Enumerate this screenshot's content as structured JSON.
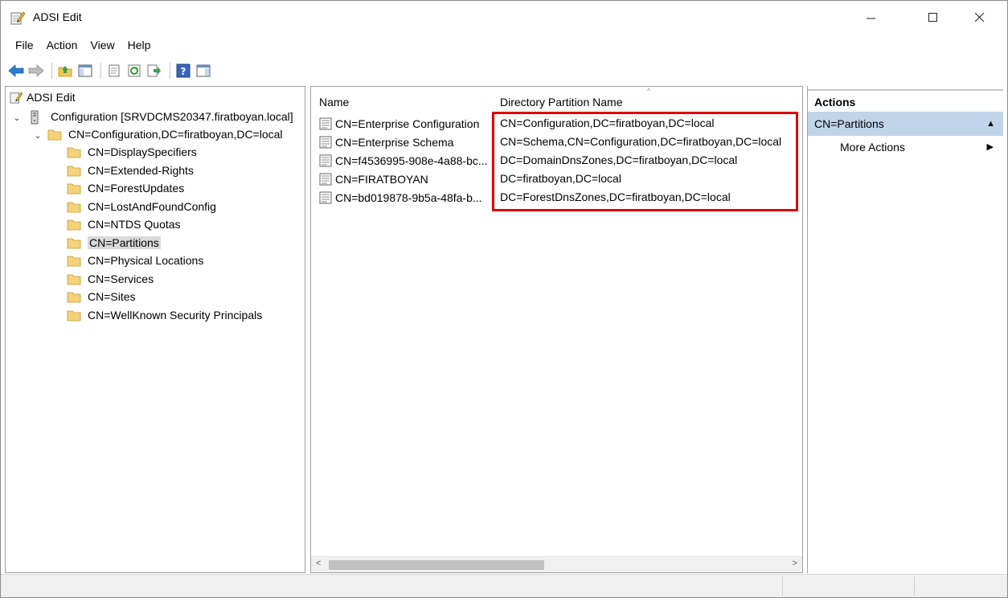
{
  "window": {
    "title": "ADSI Edit"
  },
  "menu": [
    "File",
    "Action",
    "View",
    "Help"
  ],
  "toolbar": {
    "buttons": [
      "back-arrow-icon",
      "forward-arrow-icon",
      "up-folder-icon",
      "show-hide-tree-icon",
      "properties-icon",
      "refresh-icon",
      "export-list-icon",
      "help-icon",
      "show-hide-action-pane-icon"
    ]
  },
  "tree": {
    "root": "ADSI Edit",
    "connection": "Configuration [SRVDCMS20347.firatboyan.local]",
    "container": "CN=Configuration,DC=firatboyan,DC=local",
    "children": [
      "CN=DisplaySpecifiers",
      "CN=Extended-Rights",
      "CN=ForestUpdates",
      "CN=LostAndFoundConfig",
      "CN=NTDS Quotas",
      "CN=Partitions",
      "CN=Physical Locations",
      "CN=Services",
      "CN=Sites",
      "CN=WellKnown Security Principals"
    ],
    "selected": "CN=Partitions"
  },
  "list": {
    "columns": [
      "Name",
      "Directory Partition Name"
    ],
    "rows": [
      {
        "name": "CN=Enterprise Configuration",
        "partition": "CN=Configuration,DC=firatboyan,DC=local"
      },
      {
        "name": "CN=Enterprise Schema",
        "partition": "CN=Schema,CN=Configuration,DC=firatboyan,DC=local"
      },
      {
        "name": "CN=f4536995-908e-4a88-bc...",
        "partition": "DC=DomainDnsZones,DC=firatboyan,DC=local"
      },
      {
        "name": "CN=FIRATBOYAN",
        "partition": "DC=firatboyan,DC=local"
      },
      {
        "name": "CN=bd019878-9b5a-48fa-b...",
        "partition": "DC=ForestDnsZones,DC=firatboyan,DC=local"
      }
    ]
  },
  "actions": {
    "header": "Actions",
    "section": "CN=Partitions",
    "more": "More Actions"
  },
  "colors": {
    "highlight_box": "#e00000",
    "actions_section_bg": "#c0d4ea",
    "selected_tree_bg": "#d9d9d9"
  }
}
